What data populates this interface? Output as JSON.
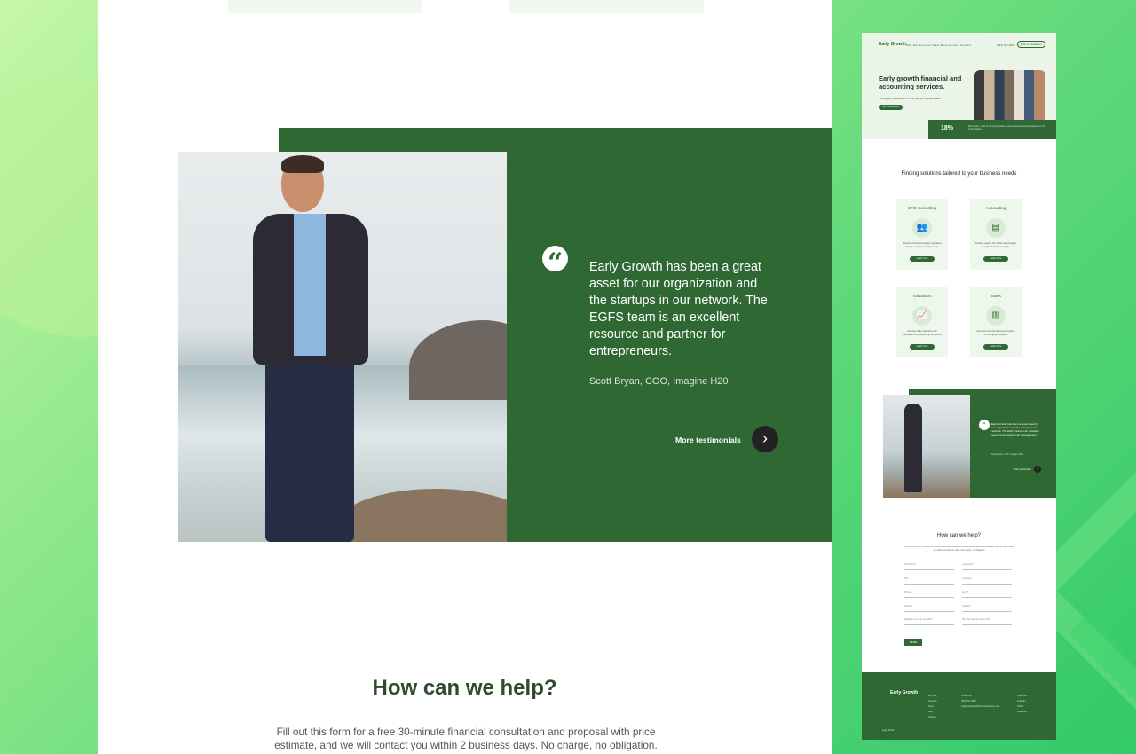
{
  "testimonial": {
    "quote": "Early Growth has been a great asset for our organization and the startups in our network. The EGFS team is an excellent resource and partner for entrepreneurs.",
    "author": "Scott Bryan, COO, Imagine H20",
    "more_label": "More testimonials",
    "quote_glyph": "“"
  },
  "help": {
    "title": "How can we help?",
    "description": "Fill out this form for a free 30-minute financial consultation and proposal with price estimate, and we will contact you within 2 business days. No charge, no obligation."
  },
  "thumbnail": {
    "logo": "Early Growth",
    "nav": "Why EG   Services   Team   Blog   Careers   Contact",
    "phone": "(833) 527-6697",
    "cta": "Free Consultation",
    "hero_title": "Early growth financial and accounting services.",
    "hero_sub": "The largest network firm in the venture capital space",
    "hero_button": "Get Consultation",
    "stat_value": "18%",
    "stat_text": "We service ~10% of currently funded, venture-backed startup companies in the United States",
    "solutions_title": "Finding solutions tailored to your business needs",
    "cards": [
      {
        "title": "CFO Consulting",
        "icon": "👥",
        "desc": "Seasoned financial partners regardless of stage, industry or project scope",
        "button": "Learn more"
      },
      {
        "title": "Accounting",
        "icon": "▤",
        "desc": "Finance support from basic accounting to complex financial oversight",
        "button": "Learn more"
      },
      {
        "title": "Valuations",
        "icon": "📈",
        "desc": "Accurate 409a valuations with guaranteed 10-business day turnaround",
        "button": "Learn more"
      },
      {
        "title": "Taxes",
        "icon": "▥",
        "desc": "Domestic and international tax support for emerging companies",
        "button": "Learn more"
      }
    ],
    "test_quote": "Early Growth has been a great asset for our organization and the startups in our network. The EGFS team is an excellent resource and partner for entrepreneurs.",
    "test_author": "Scott Bryan, COO, Imagine H20",
    "test_more": "More testimonials",
    "help_title": "How can we help?",
    "help_desc": "Fill out this form for a free 30-minute financial consultation and proposal with price estimate, and we will contact you within 2 business days. No charge, no obligation.",
    "fields": [
      "First Name*",
      "Last Name*",
      "Title",
      "Company",
      "Phone*",
      "Email*",
      "Website",
      "Industry*",
      "What can we help you with?*",
      "How did you hear about us?"
    ],
    "send": "SEND",
    "footer_logo": "Early Growth",
    "footer_links": "Why EG\nServices\nTeam\nBlog\nCareers",
    "footer_contact": "Contact us\n(833) 527-6697\ninfo@earlygrowthfinancialservices.com",
    "footer_social": "Facebook\nLinkedIn\nTwitter\nInstagram",
    "footer_copy": "Legal   Privacy"
  }
}
